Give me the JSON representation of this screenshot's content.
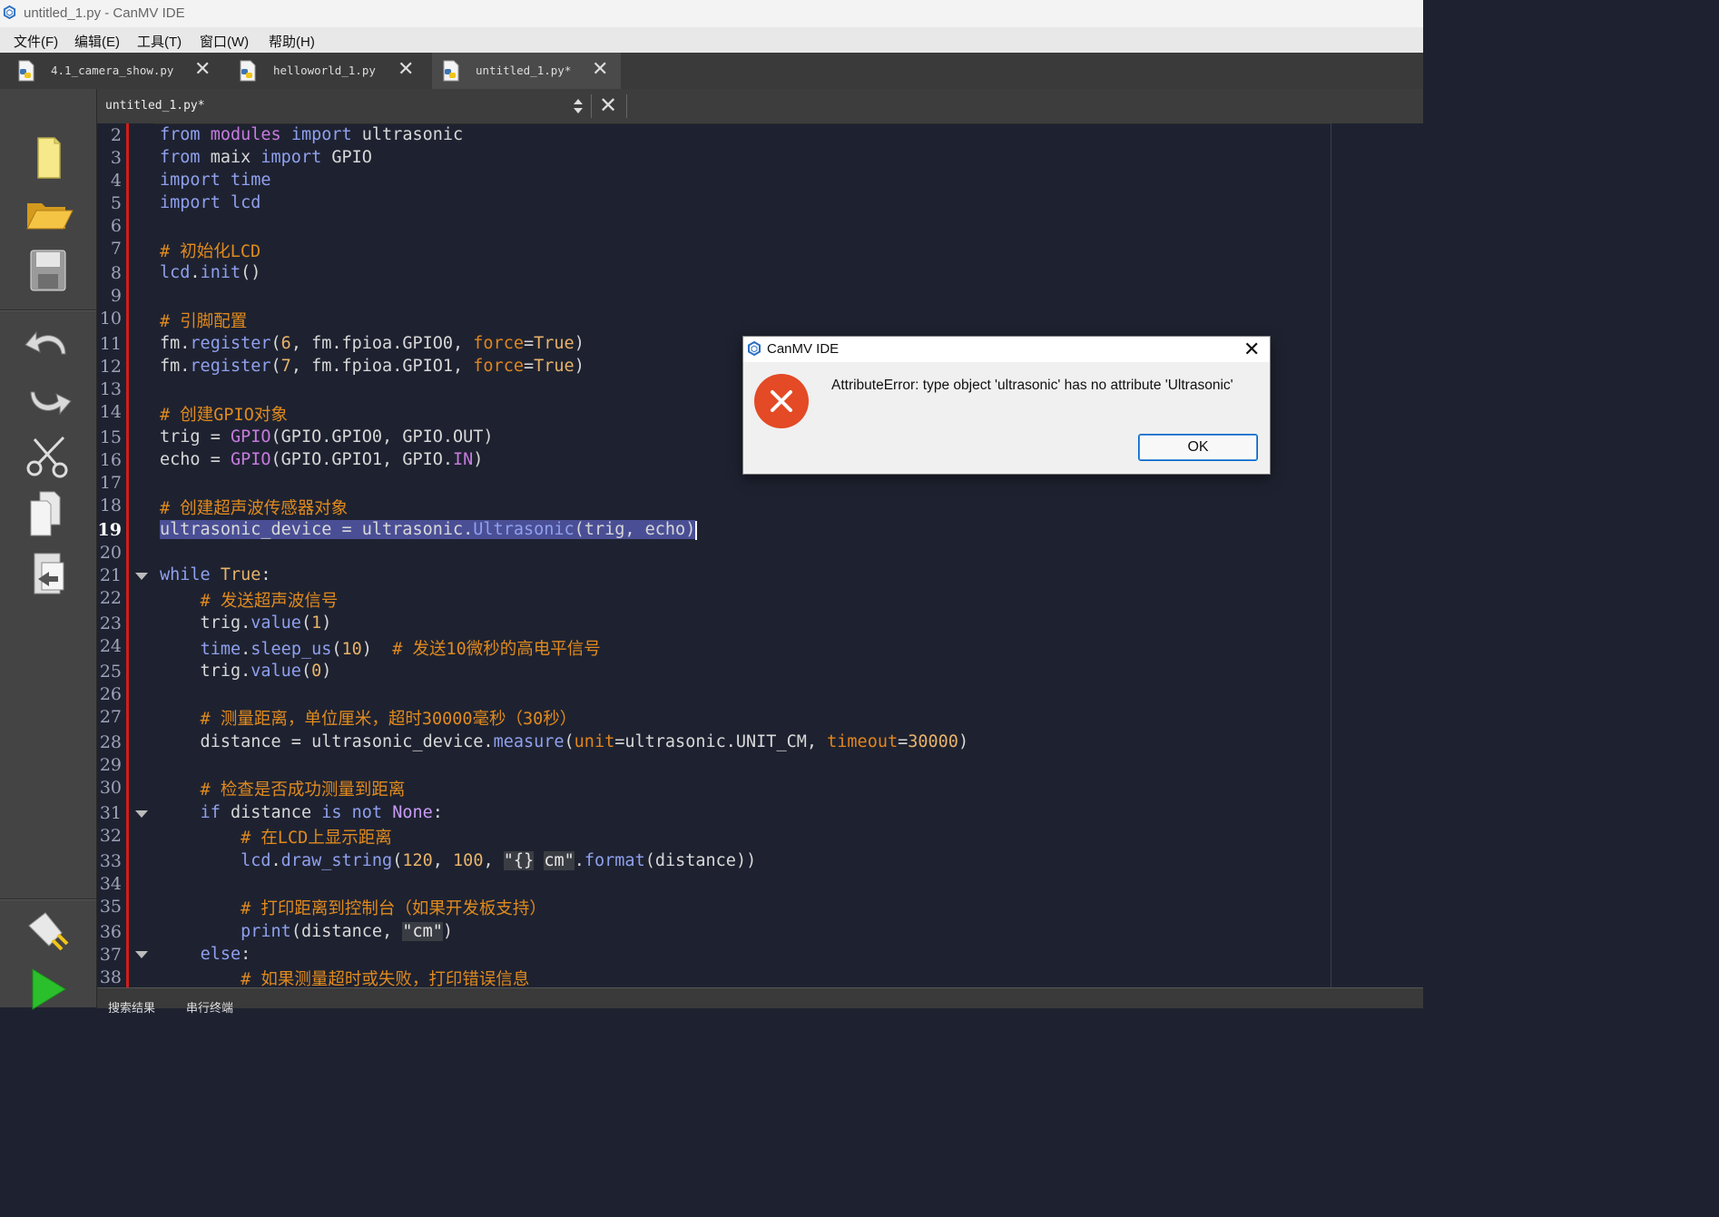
{
  "window": {
    "title": "untitled_1.py - CanMV IDE"
  },
  "menu": [
    {
      "label": "文件(F)"
    },
    {
      "label": "编辑(E)"
    },
    {
      "label": "工具(T)"
    },
    {
      "label": "窗口(W)"
    },
    {
      "label": "帮助(H)"
    }
  ],
  "tabs": [
    {
      "label": "4.1_camera_show.py",
      "active": false
    },
    {
      "label": "helloworld_1.py",
      "active": false
    },
    {
      "label": "untitled_1.py*",
      "active": true
    }
  ],
  "editor": {
    "file_selector": "untitled_1.py*",
    "current_line": 19,
    "line_numbers": [
      "2",
      "3",
      "4",
      "5",
      "6",
      "7",
      "8",
      "9",
      "10",
      "11",
      "12",
      "13",
      "14",
      "15",
      "16",
      "17",
      "18",
      "19",
      "20",
      "21",
      "22",
      "23",
      "24",
      "25",
      "26",
      "27",
      "28",
      "29",
      "30",
      "31",
      "32",
      "33",
      "34",
      "35",
      "36",
      "37",
      "38"
    ],
    "lines": [
      "from modules import ultrasonic",
      "from maix import GPIO",
      "import time",
      "import lcd",
      "",
      "# 初始化LCD",
      "lcd.init()",
      "",
      "# 引脚配置",
      "fm.register(6, fm.fpioa.GPIO0, force=True)",
      "fm.register(7, fm.fpioa.GPIO1, force=True)",
      "",
      "# 创建GPIO对象",
      "trig = GPIO(GPIO.GPIO0, GPIO.OUT)",
      "echo = GPIO(GPIO.GPIO1, GPIO.IN)",
      "",
      "# 创建超声波传感器对象",
      "ultrasonic_device = ultrasonic.Ultrasonic(trig, echo)",
      "",
      "while True:",
      "    # 发送超声波信号",
      "    trig.value(1)",
      "    time.sleep_us(10)  # 发送10微秒的高电平信号",
      "    trig.value(0)",
      "",
      "    # 测量距离，单位厘米，超时30000毫秒（30秒）",
      "    distance = ultrasonic_device.measure(unit=ultrasonic.UNIT_CM, timeout=30000)",
      "",
      "    # 检查是否成功测量到距离",
      "    if distance is not None:",
      "        # 在LCD上显示距离",
      "        lcd.draw_string(120, 100, \"{} cm\".format(distance))",
      "",
      "        # 打印距离到控制台（如果开发板支持）",
      "        print(distance, \"cm\")",
      "    else:",
      "        # 如果测量超时或失败，打印错误信息"
    ]
  },
  "sidebar": {
    "tools": [
      "new-file-icon",
      "open-folder-icon",
      "save-icon",
      "undo-icon",
      "redo-icon",
      "cut-icon",
      "copy-icon",
      "paste-icon",
      "connect-icon",
      "run-icon"
    ]
  },
  "bottom_tabs": [
    "搜索结果",
    "串行终端"
  ],
  "dialog": {
    "title": "CanMV IDE",
    "message": "AttributeError: type object 'ultrasonic' has no attribute 'Ultrasonic'",
    "ok_label": "OK"
  },
  "colors": {
    "editor_bg": "#1e2230",
    "keyword": "#8fa0ee",
    "comment": "#e08a1e",
    "selection": "#4a4f95",
    "error_icon": "#e34a25"
  }
}
